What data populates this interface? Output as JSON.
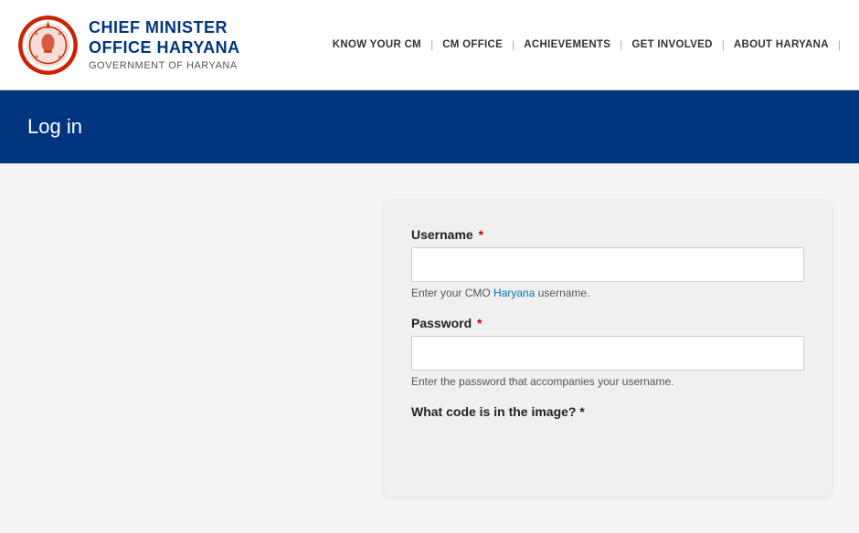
{
  "header": {
    "org_title_line1": "CHIEF MINISTER",
    "org_title_line2": "OFFICE HARYANA",
    "org_subtitle": "GOVERNMENT OF HARYANA",
    "nav": {
      "know_cm": "KNOW YOUR CM",
      "cm_office": "CM OFFICE",
      "achievements": "ACHIEVEMENTS",
      "get_involved": "GET INVOLVED",
      "about_haryana": "ABOUT HARYANA"
    }
  },
  "banner": {
    "title": "Log in"
  },
  "form": {
    "username_label": "Username",
    "username_hint_pre": "Enter your CMO ",
    "username_hint_link": "Haryana",
    "username_hint_post": " username.",
    "password_label": "Password",
    "password_hint": "Enter the password that accompanies your username.",
    "captcha_question": "What code is in the image?"
  },
  "colors": {
    "nav_blue": "#003580",
    "red": "#cc0000",
    "link_blue": "#0073aa"
  }
}
